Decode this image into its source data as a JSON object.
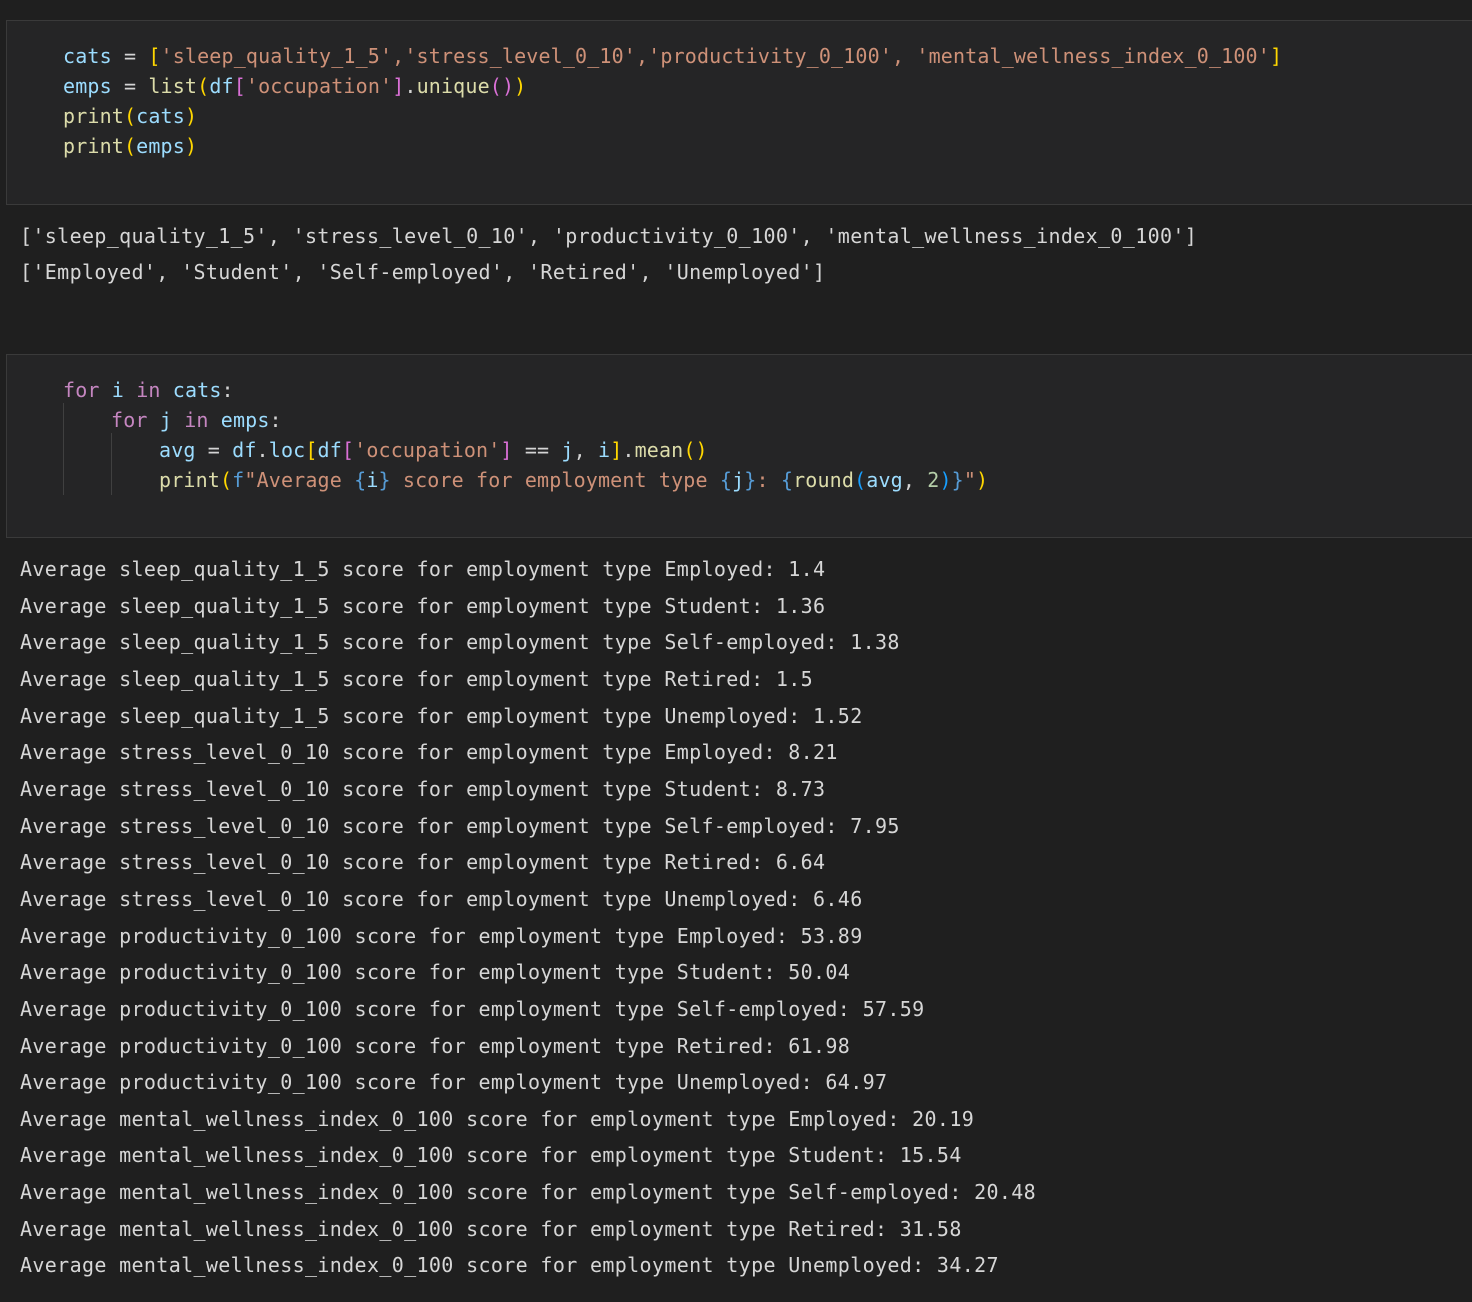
{
  "cell1": {
    "code": {
      "cats_name": "cats",
      "cats_list": "'sleep_quality_1_5','stress_level_0_10','productivity_0_100', 'mental_wellness_index_0_100'",
      "emps_name": "emps",
      "list_fn": "list",
      "df": "df",
      "occupation_key": "'occupation'",
      "unique_fn": "unique",
      "print_fn": "print"
    },
    "output": [
      "['sleep_quality_1_5', 'stress_level_0_10', 'productivity_0_100', 'mental_wellness_index_0_100']",
      "['Employed', 'Student', 'Self-employed', 'Retired', 'Unemployed']"
    ]
  },
  "cell2": {
    "code": {
      "for_kw": "for",
      "in_kw": "in",
      "i": "i",
      "j": "j",
      "cats": "cats",
      "emps": "emps",
      "avg": "avg",
      "df": "df",
      "loc": "loc",
      "occupation_key": "'occupation'",
      "mean": "mean",
      "print_fn": "print",
      "f_prefix": "f",
      "fstr_a": "\"Average ",
      "fstr_b": " score for employment type ",
      "fstr_c": ": ",
      "fstr_end": "\"",
      "round_fn": "round",
      "two": "2"
    },
    "output": [
      "Average sleep_quality_1_5 score for employment type Employed: 1.4",
      "Average sleep_quality_1_5 score for employment type Student: 1.36",
      "Average sleep_quality_1_5 score for employment type Self-employed: 1.38",
      "Average sleep_quality_1_5 score for employment type Retired: 1.5",
      "Average sleep_quality_1_5 score for employment type Unemployed: 1.52",
      "Average stress_level_0_10 score for employment type Employed: 8.21",
      "Average stress_level_0_10 score for employment type Student: 8.73",
      "Average stress_level_0_10 score for employment type Self-employed: 7.95",
      "Average stress_level_0_10 score for employment type Retired: 6.64",
      "Average stress_level_0_10 score for employment type Unemployed: 6.46",
      "Average productivity_0_100 score for employment type Employed: 53.89",
      "Average productivity_0_100 score for employment type Student: 50.04",
      "Average productivity_0_100 score for employment type Self-employed: 57.59",
      "Average productivity_0_100 score for employment type Retired: 61.98",
      "Average productivity_0_100 score for employment type Unemployed: 64.97",
      "Average mental_wellness_index_0_100 score for employment type Employed: 20.19",
      "Average mental_wellness_index_0_100 score for employment type Student: 15.54",
      "Average mental_wellness_index_0_100 score for employment type Self-employed: 20.48",
      "Average mental_wellness_index_0_100 score for employment type Retired: 31.58",
      "Average mental_wellness_index_0_100 score for employment type Unemployed: 34.27"
    ]
  },
  "colors": {
    "background": "#1f1f1f",
    "cell_background": "#252526",
    "keyword": "#c586c0",
    "variable": "#9cdcfe",
    "function": "#dcdcaa",
    "string": "#ce9178",
    "number": "#b5cea8"
  }
}
